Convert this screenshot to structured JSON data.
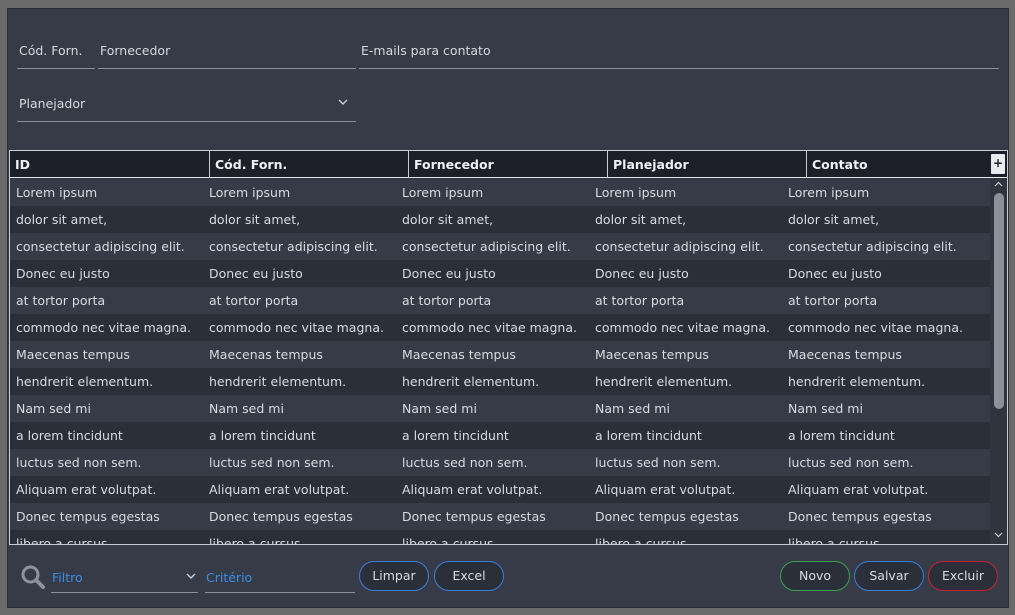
{
  "form": {
    "cod_forn_label": "Cód. Forn.",
    "fornecedor_label": "Fornecedor",
    "emails_label": "E-mails para contato",
    "planejador_label": "Planejador"
  },
  "table": {
    "columns": [
      "ID",
      "Cód. Forn.",
      "Fornecedor",
      "Planejador",
      "Contato"
    ],
    "add_column_symbol": "+",
    "rows": [
      [
        "Lorem ipsum",
        "Lorem ipsum",
        "Lorem ipsum",
        "Lorem ipsum",
        "Lorem ipsum"
      ],
      [
        "dolor sit amet,",
        "dolor sit amet,",
        "dolor sit amet,",
        "dolor sit amet,",
        "dolor sit amet,"
      ],
      [
        "consectetur adipiscing elit.",
        "consectetur adipiscing elit.",
        "consectetur adipiscing elit.",
        "consectetur adipiscing elit.",
        "consectetur adipiscing elit."
      ],
      [
        "Donec eu justo",
        "Donec eu justo",
        "Donec eu justo",
        "Donec eu justo",
        "Donec eu justo"
      ],
      [
        "at tortor porta",
        "at tortor porta",
        "at tortor porta",
        "at tortor porta",
        "at tortor porta"
      ],
      [
        "commodo nec vitae magna.",
        "commodo nec vitae magna.",
        "commodo nec vitae magna.",
        "commodo nec vitae magna.",
        "commodo nec vitae magna."
      ],
      [
        "Maecenas tempus",
        "Maecenas tempus",
        "Maecenas tempus",
        "Maecenas tempus",
        "Maecenas tempus"
      ],
      [
        "hendrerit elementum.",
        "hendrerit elementum.",
        "hendrerit elementum.",
        "hendrerit elementum.",
        "hendrerit elementum."
      ],
      [
        "Nam sed mi",
        "Nam sed mi",
        "Nam sed mi",
        "Nam sed mi",
        "Nam sed mi"
      ],
      [
        "a lorem tincidunt",
        "a lorem tincidunt",
        "a lorem tincidunt",
        "a lorem tincidunt",
        "a lorem tincidunt"
      ],
      [
        "luctus sed non sem.",
        "luctus sed non sem.",
        "luctus sed non sem.",
        "luctus sed non sem.",
        "luctus sed non sem."
      ],
      [
        "Aliquam erat volutpat.",
        "Aliquam erat volutpat.",
        "Aliquam erat volutpat.",
        "Aliquam erat volutpat.",
        "Aliquam erat volutpat."
      ],
      [
        "Donec tempus egestas",
        "Donec tempus egestas",
        "Donec tempus egestas",
        "Donec tempus egestas",
        "Donec tempus egestas"
      ],
      [
        "libero a cursus.",
        "libero a cursus.",
        "libero a cursus.",
        "libero a cursus.",
        "libero a cursus."
      ]
    ]
  },
  "footer": {
    "filter_placeholder": "Filtro",
    "criterio_placeholder": "Critério",
    "limpar_label": "Limpar",
    "excel_label": "Excel",
    "novo_label": "Novo",
    "salvar_label": "Salvar",
    "excluir_label": "Excluir"
  },
  "icons": {
    "search": "search-icon",
    "dropdown": "chevron-down-icon",
    "scroll_up": "chevron-up-icon",
    "scroll_down": "chevron-down-icon"
  },
  "colors": {
    "background": "#363b47",
    "accent_blue": "#3a7fd6",
    "novo_border": "#3aa04e",
    "excluir_border": "#c8242d",
    "placeholder_blue": "#3b8ee8"
  }
}
